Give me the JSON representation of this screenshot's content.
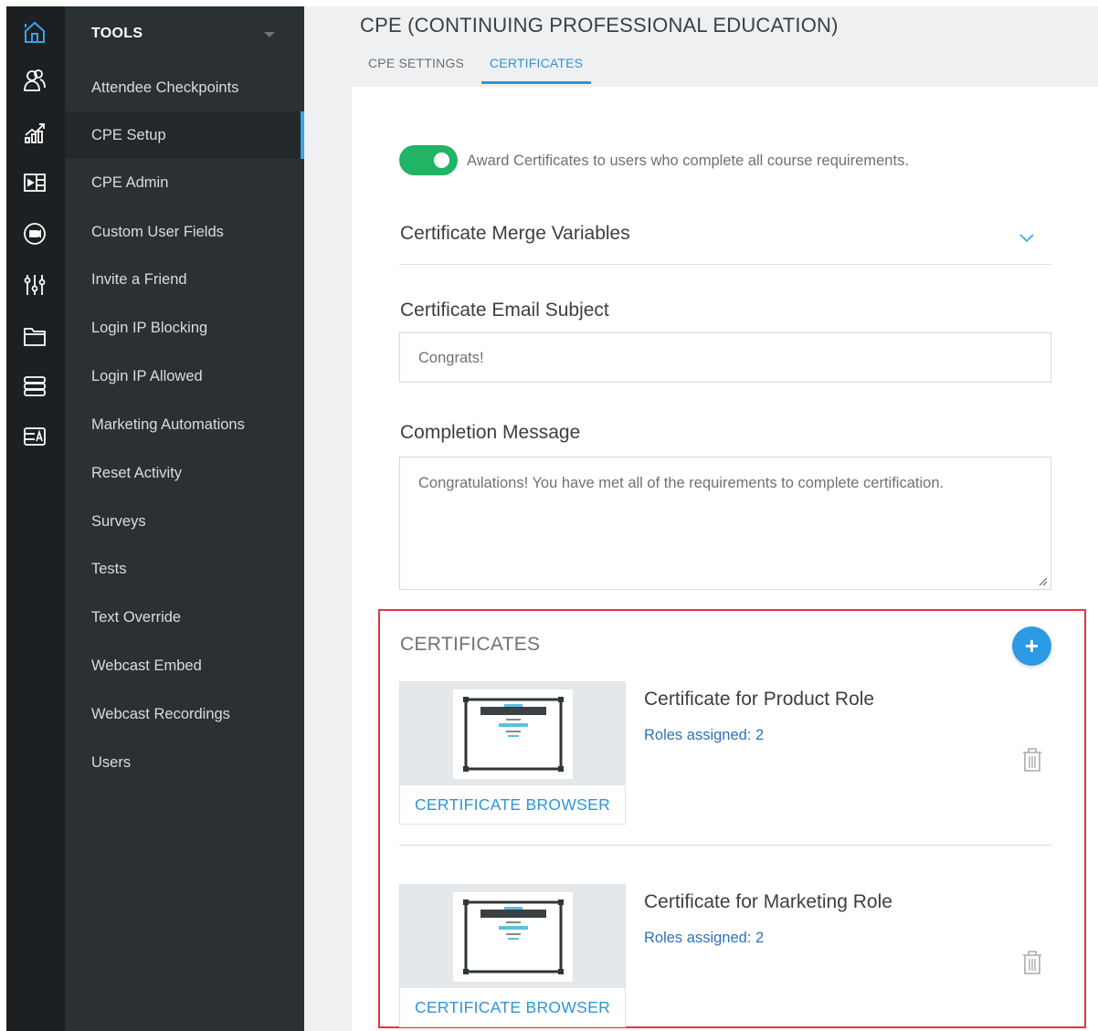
{
  "rail": {
    "icons": [
      "home-icon",
      "users-icon",
      "analytics-icon",
      "media-icon",
      "video-icon",
      "sliders-icon",
      "folder-icon",
      "database-icon",
      "badge-icon"
    ]
  },
  "menu": {
    "header": "TOOLS",
    "items": [
      {
        "label": "Attendee Checkpoints"
      },
      {
        "label": "CPE Setup",
        "active": true
      },
      {
        "label": "CPE Admin"
      },
      {
        "label": "Custom User Fields"
      },
      {
        "label": "Invite a Friend"
      },
      {
        "label": "Login IP Blocking"
      },
      {
        "label": "Login IP Allowed"
      },
      {
        "label": "Marketing Automations"
      },
      {
        "label": "Reset Activity"
      },
      {
        "label": "Surveys"
      },
      {
        "label": "Tests"
      },
      {
        "label": "Text Override"
      },
      {
        "label": "Webcast Embed"
      },
      {
        "label": "Webcast Recordings"
      },
      {
        "label": "Users"
      }
    ]
  },
  "page": {
    "title": "CPE (CONTINUING PROFESSIONAL EDUCATION)",
    "tabs": [
      {
        "label": "CPE SETTINGS"
      },
      {
        "label": "CERTIFICATES",
        "active": true
      }
    ]
  },
  "settings": {
    "award_toggle_on": true,
    "award_label": "Award Certificates to users who complete all course requirements.",
    "merge_variables_label": "Certificate Merge Variables",
    "email_subject_label": "Certificate Email Subject",
    "email_subject_value": "Congrats!",
    "completion_label": "Completion Message",
    "completion_value": "Congratulations! You have met all of the requirements to complete certification."
  },
  "certificates": {
    "title": "CERTIFICATES",
    "add_label": "+",
    "items": [
      {
        "name": "Certificate for Product Role",
        "roles": "Roles assigned: 2",
        "browser_label": "CERTIFICATE BROWSER"
      },
      {
        "name": "Certificate for Marketing Role",
        "roles": "Roles assigned: 2",
        "browser_label": "CERTIFICATE BROWSER"
      }
    ]
  },
  "colors": {
    "accent": "#2f95d6",
    "toggle_on": "#20b464",
    "highlight": "#e2373e",
    "sidebar": "#2b3033",
    "rail": "#1c2022"
  }
}
